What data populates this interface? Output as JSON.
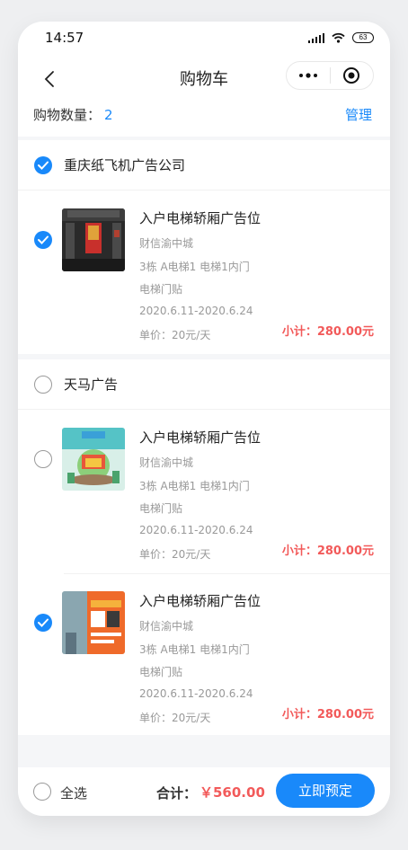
{
  "status": {
    "time": "14:57",
    "battery": "63"
  },
  "nav": {
    "title": "购物车"
  },
  "summary": {
    "count_label": "购物数量：",
    "count": "2",
    "manage_label": "管理"
  },
  "groups": [
    {
      "name": "重庆纸飞机广告公司",
      "checked": true,
      "items": [
        {
          "title": "入户电梯轿厢广告位",
          "location": "财信渝中城",
          "position": "3栋 A电梯1 电梯1内门",
          "type": "电梯门贴",
          "dates": "2020.6.11-2020.6.24",
          "price": "单价：20元/天",
          "subtotal": "小计：280.00元",
          "checked": true,
          "thumb": "elevator-photo"
        }
      ]
    },
    {
      "name": "天马广告",
      "checked": false,
      "items": [
        {
          "title": "入户电梯轿厢广告位",
          "location": "财信渝中城",
          "position": "3栋 A电梯1 电梯1内门",
          "type": "电梯门贴",
          "dates": "2020.6.11-2020.6.24",
          "price": "单价：20元/天",
          "subtotal": "小计：280.00元",
          "checked": false,
          "thumb": "poster-illustration"
        },
        {
          "title": "入户电梯轿厢广告位",
          "location": "财信渝中城",
          "position": "3栋 A电梯1 电梯1内门",
          "type": "电梯门贴",
          "dates": "2020.6.11-2020.6.24",
          "price": "单价：20元/天",
          "subtotal": "小计：280.00元",
          "checked": true,
          "thumb": "orange-poster-photo"
        }
      ]
    }
  ],
  "footer": {
    "select_all": "全选",
    "total_label": "合计：",
    "total": "￥560.00",
    "submit": "立即预定"
  },
  "colors": {
    "accent": "#1989fa",
    "price": "#f25a5a"
  }
}
